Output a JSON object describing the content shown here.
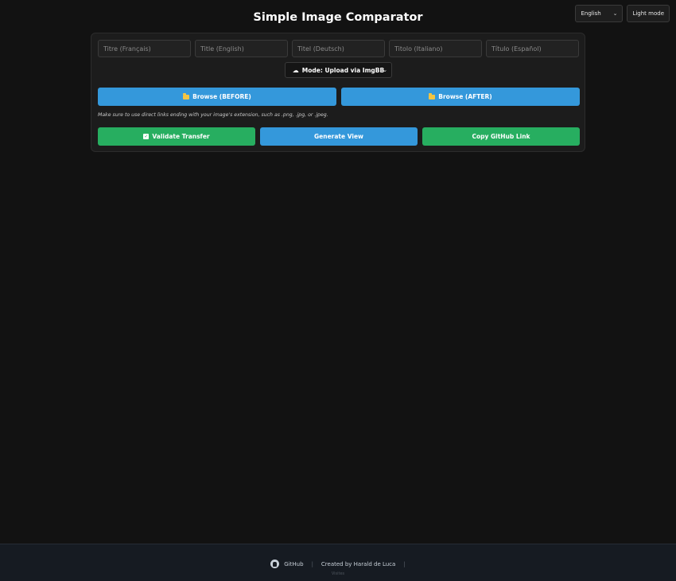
{
  "header": {
    "title": "Simple Image Comparator",
    "language": "English",
    "theme_toggle": "Light mode"
  },
  "titles": [
    {
      "placeholder": "Titre (Français)"
    },
    {
      "placeholder": "Title (English)"
    },
    {
      "placeholder": "Titel (Deutsch)"
    },
    {
      "placeholder": "Titolo (Italiano)"
    },
    {
      "placeholder": "Título (Español)"
    }
  ],
  "mode": {
    "label": "Mode: Upload via ImgBB",
    "icon": "cloud-icon"
  },
  "browse": {
    "before_label": "Browse (BEFORE)",
    "after_label": "Browse (AFTER)",
    "icon": "folder-icon"
  },
  "hint": "Make sure to use direct links ending with your image's extension, such as .png, .jpg, or .jpeg.",
  "actions": {
    "validate_label": "Validate Transfer",
    "generate_label": "Generate View",
    "copy_label": "Copy GitHub Link"
  },
  "footer": {
    "github_label": "GitHub",
    "separator": "|",
    "credit": "Created by Harald de Luca",
    "visits": "Visites"
  },
  "colors": {
    "background": "#121212",
    "panel": "#1c1c1c",
    "blue": "#3498db",
    "green": "#27ae60",
    "footer": "#161b22"
  }
}
